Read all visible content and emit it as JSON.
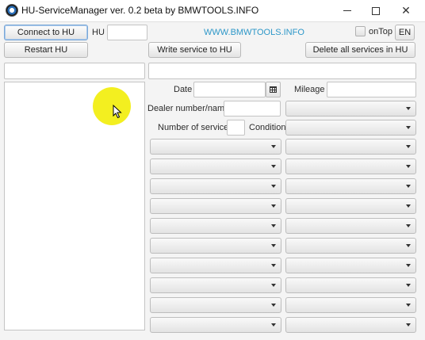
{
  "window": {
    "title": "HU-ServiceManager ver. 0.2 beta by BMWTOOLS.INFO",
    "min_glyph": "",
    "max_glyph": "",
    "close_glyph": "✕"
  },
  "toolbar": {
    "connect_label": "Connect to HU",
    "hu_label": "HU",
    "hu_value": "",
    "website_link": "WWW.BMWTOOLS.INFO",
    "ontop_label": "onTop",
    "ontop_checked": false,
    "language_label": "EN",
    "restart_label": "Restart HU",
    "write_label": "Write service to HU",
    "delete_label": "Delete all services in HU"
  },
  "status": {
    "left_value": "",
    "right_value": ""
  },
  "form": {
    "date_label": "Date",
    "date_value": "",
    "mileage_label": "Mileage",
    "mileage_value": "",
    "dealer_label": "Dealer number/name",
    "dealer_value": "",
    "dealer_select_value": "",
    "num_services_label": "Number of services",
    "num_services_value": "",
    "condition_label": "Condition",
    "condition_value": ""
  },
  "service_rows": [
    {
      "left": "",
      "right": ""
    },
    {
      "left": "",
      "right": ""
    },
    {
      "left": "",
      "right": ""
    },
    {
      "left": "",
      "right": ""
    },
    {
      "left": "",
      "right": ""
    },
    {
      "left": "",
      "right": ""
    },
    {
      "left": "",
      "right": ""
    },
    {
      "left": "",
      "right": ""
    },
    {
      "left": "",
      "right": ""
    },
    {
      "left": "",
      "right": ""
    }
  ],
  "services_list": []
}
